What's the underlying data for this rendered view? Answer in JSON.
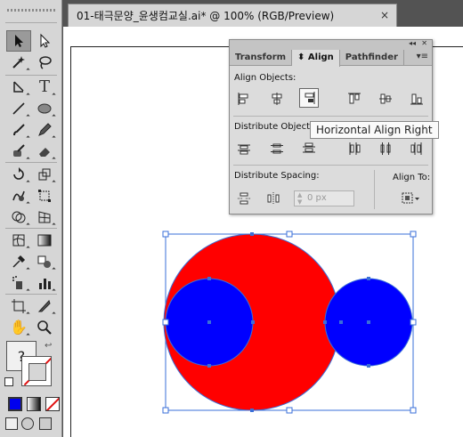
{
  "document": {
    "tab_title": "01-태극문양_윤생컴교실.ai* @ 100% (RGB/Preview)",
    "close_glyph": "×"
  },
  "panel": {
    "tabs": [
      {
        "label": "Transform",
        "active": false
      },
      {
        "label": "Align",
        "active": true,
        "prefix_icon": "up-down-arrows-icon"
      },
      {
        "label": "Pathfinder",
        "active": false
      }
    ],
    "collapse_glyph": "◂◂",
    "close_glyph": "✕",
    "menu_glyph": "▾≡",
    "align_objects_label": "Align Objects:",
    "distribute_objects_label": "Distribute Objects:",
    "distribute_spacing_label": "Distribute Spacing:",
    "align_to_label": "Align To:",
    "spacing_value": "0 px",
    "align_objects_buttons": [
      "horizontal-align-left-icon",
      "horizontal-align-center-icon",
      "horizontal-align-right-icon",
      "vertical-align-top-icon",
      "vertical-align-center-icon",
      "vertical-align-bottom-icon"
    ],
    "pressed_button": "horizontal-align-right-icon"
  },
  "tooltip": {
    "text": "Horizontal Align Right"
  },
  "toolbar": {
    "active_tool": "selection-tool",
    "swap_glyph": "?",
    "fill_color": "#f0f0f0",
    "stroke_none_color": "#e01010"
  },
  "artwork": {
    "big_circle_fill": "#ff0000",
    "small_circle_fill": "#0000ff",
    "selection_color": "#3a6fd8"
  }
}
